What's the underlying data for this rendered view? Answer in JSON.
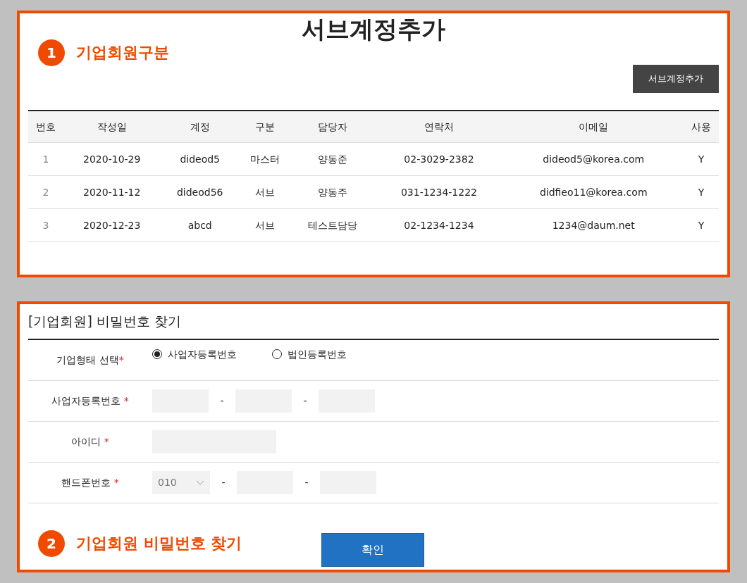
{
  "sub_account_panel": {
    "title": "서브계정추가",
    "callout": {
      "number": "1",
      "label": "기업회원구분"
    },
    "add_button": "서브계정추가",
    "table": {
      "columns": [
        "번호",
        "작성일",
        "계정",
        "구분",
        "담당자",
        "연락처",
        "이메일",
        "사용"
      ],
      "rows": [
        [
          "1",
          "2020-10-29",
          "dideod5",
          "마스터",
          "양동준",
          "02-3029-2382",
          "dideod5@korea.com",
          "Y"
        ],
        [
          "2",
          "2020-11-12",
          "dideod56",
          "서브",
          "양동주",
          "031-1234-1222",
          "didfieo11@korea.com",
          "Y"
        ],
        [
          "3",
          "2020-12-23",
          "abcd",
          "서브",
          "테스트담당",
          "02-1234-1234",
          "1234@daum.net",
          "Y"
        ]
      ]
    }
  },
  "password_panel": {
    "title": "[기업회원] 비밀번호 찾기",
    "form_rows": [
      {
        "kind": "radio",
        "label": "기업형태 선택",
        "required_mark": "*",
        "options": [
          {
            "label": "사업자등록번호",
            "selected": true
          },
          {
            "label": "법인등록번호",
            "selected": false
          }
        ]
      },
      {
        "kind": "split",
        "label": "사업자등록번호",
        "required_mark": "*",
        "separators": [
          "-",
          "-"
        ]
      },
      {
        "kind": "text",
        "label": "아이디",
        "required_mark": "*"
      },
      {
        "kind": "phone",
        "label": "핸드폰번호",
        "required_mark": "*",
        "prefix_value": "010",
        "separators": [
          "-",
          "-"
        ]
      }
    ],
    "callout": {
      "number": "2",
      "label": "기업회원 비밀번호 찾기"
    },
    "confirm_button": "확인"
  }
}
